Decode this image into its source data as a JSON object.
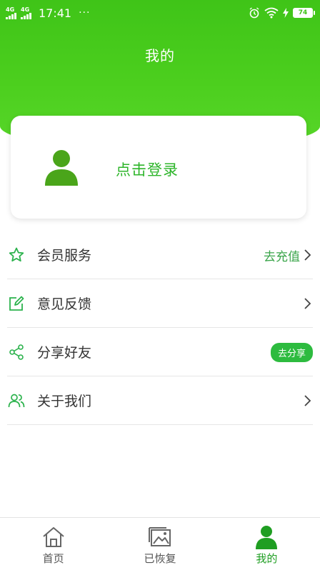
{
  "status_bar": {
    "network_1": "4G",
    "network_2": "4G",
    "time": "17:41",
    "more": "···",
    "battery": "74"
  },
  "header": {
    "title": "我的"
  },
  "login_card": {
    "text": "点击登录"
  },
  "menu": {
    "items": [
      {
        "label": "会员服务",
        "hint": "去充值",
        "icon": "star-icon"
      },
      {
        "label": "意见反馈",
        "icon": "edit-icon"
      },
      {
        "label": "分享好友",
        "badge": "去分享",
        "icon": "share-icon"
      },
      {
        "label": "关于我们",
        "icon": "users-icon"
      }
    ]
  },
  "tabbar": {
    "tabs": [
      {
        "label": "首页",
        "icon": "home-icon"
      },
      {
        "label": "已恢复",
        "icon": "image-icon"
      },
      {
        "label": "我的",
        "icon": "user-icon",
        "active": true
      }
    ]
  },
  "colors": {
    "brand_green": "#3fc418",
    "accent_text": "#2db52a",
    "icon_green": "#2bb24c",
    "avatar_green": "#4aa51a"
  }
}
